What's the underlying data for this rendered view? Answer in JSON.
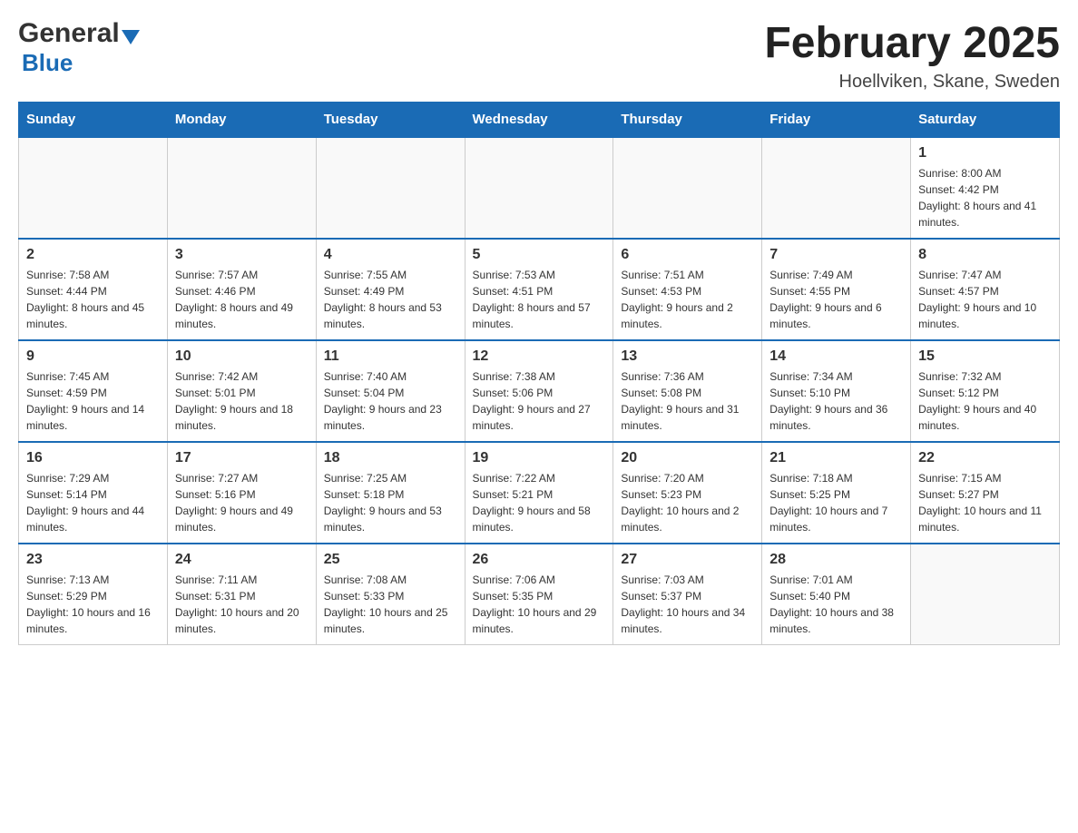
{
  "logo": {
    "general": "General",
    "blue": "Blue"
  },
  "header": {
    "title": "February 2025",
    "location": "Hoellviken, Skane, Sweden"
  },
  "weekdays": [
    "Sunday",
    "Monday",
    "Tuesday",
    "Wednesday",
    "Thursday",
    "Friday",
    "Saturday"
  ],
  "weeks": [
    [
      {
        "day": "",
        "info": ""
      },
      {
        "day": "",
        "info": ""
      },
      {
        "day": "",
        "info": ""
      },
      {
        "day": "",
        "info": ""
      },
      {
        "day": "",
        "info": ""
      },
      {
        "day": "",
        "info": ""
      },
      {
        "day": "1",
        "info": "Sunrise: 8:00 AM\nSunset: 4:42 PM\nDaylight: 8 hours and 41 minutes."
      }
    ],
    [
      {
        "day": "2",
        "info": "Sunrise: 7:58 AM\nSunset: 4:44 PM\nDaylight: 8 hours and 45 minutes."
      },
      {
        "day": "3",
        "info": "Sunrise: 7:57 AM\nSunset: 4:46 PM\nDaylight: 8 hours and 49 minutes."
      },
      {
        "day": "4",
        "info": "Sunrise: 7:55 AM\nSunset: 4:49 PM\nDaylight: 8 hours and 53 minutes."
      },
      {
        "day": "5",
        "info": "Sunrise: 7:53 AM\nSunset: 4:51 PM\nDaylight: 8 hours and 57 minutes."
      },
      {
        "day": "6",
        "info": "Sunrise: 7:51 AM\nSunset: 4:53 PM\nDaylight: 9 hours and 2 minutes."
      },
      {
        "day": "7",
        "info": "Sunrise: 7:49 AM\nSunset: 4:55 PM\nDaylight: 9 hours and 6 minutes."
      },
      {
        "day": "8",
        "info": "Sunrise: 7:47 AM\nSunset: 4:57 PM\nDaylight: 9 hours and 10 minutes."
      }
    ],
    [
      {
        "day": "9",
        "info": "Sunrise: 7:45 AM\nSunset: 4:59 PM\nDaylight: 9 hours and 14 minutes."
      },
      {
        "day": "10",
        "info": "Sunrise: 7:42 AM\nSunset: 5:01 PM\nDaylight: 9 hours and 18 minutes."
      },
      {
        "day": "11",
        "info": "Sunrise: 7:40 AM\nSunset: 5:04 PM\nDaylight: 9 hours and 23 minutes."
      },
      {
        "day": "12",
        "info": "Sunrise: 7:38 AM\nSunset: 5:06 PM\nDaylight: 9 hours and 27 minutes."
      },
      {
        "day": "13",
        "info": "Sunrise: 7:36 AM\nSunset: 5:08 PM\nDaylight: 9 hours and 31 minutes."
      },
      {
        "day": "14",
        "info": "Sunrise: 7:34 AM\nSunset: 5:10 PM\nDaylight: 9 hours and 36 minutes."
      },
      {
        "day": "15",
        "info": "Sunrise: 7:32 AM\nSunset: 5:12 PM\nDaylight: 9 hours and 40 minutes."
      }
    ],
    [
      {
        "day": "16",
        "info": "Sunrise: 7:29 AM\nSunset: 5:14 PM\nDaylight: 9 hours and 44 minutes."
      },
      {
        "day": "17",
        "info": "Sunrise: 7:27 AM\nSunset: 5:16 PM\nDaylight: 9 hours and 49 minutes."
      },
      {
        "day": "18",
        "info": "Sunrise: 7:25 AM\nSunset: 5:18 PM\nDaylight: 9 hours and 53 minutes."
      },
      {
        "day": "19",
        "info": "Sunrise: 7:22 AM\nSunset: 5:21 PM\nDaylight: 9 hours and 58 minutes."
      },
      {
        "day": "20",
        "info": "Sunrise: 7:20 AM\nSunset: 5:23 PM\nDaylight: 10 hours and 2 minutes."
      },
      {
        "day": "21",
        "info": "Sunrise: 7:18 AM\nSunset: 5:25 PM\nDaylight: 10 hours and 7 minutes."
      },
      {
        "day": "22",
        "info": "Sunrise: 7:15 AM\nSunset: 5:27 PM\nDaylight: 10 hours and 11 minutes."
      }
    ],
    [
      {
        "day": "23",
        "info": "Sunrise: 7:13 AM\nSunset: 5:29 PM\nDaylight: 10 hours and 16 minutes."
      },
      {
        "day": "24",
        "info": "Sunrise: 7:11 AM\nSunset: 5:31 PM\nDaylight: 10 hours and 20 minutes."
      },
      {
        "day": "25",
        "info": "Sunrise: 7:08 AM\nSunset: 5:33 PM\nDaylight: 10 hours and 25 minutes."
      },
      {
        "day": "26",
        "info": "Sunrise: 7:06 AM\nSunset: 5:35 PM\nDaylight: 10 hours and 29 minutes."
      },
      {
        "day": "27",
        "info": "Sunrise: 7:03 AM\nSunset: 5:37 PM\nDaylight: 10 hours and 34 minutes."
      },
      {
        "day": "28",
        "info": "Sunrise: 7:01 AM\nSunset: 5:40 PM\nDaylight: 10 hours and 38 minutes."
      },
      {
        "day": "",
        "info": ""
      }
    ]
  ]
}
